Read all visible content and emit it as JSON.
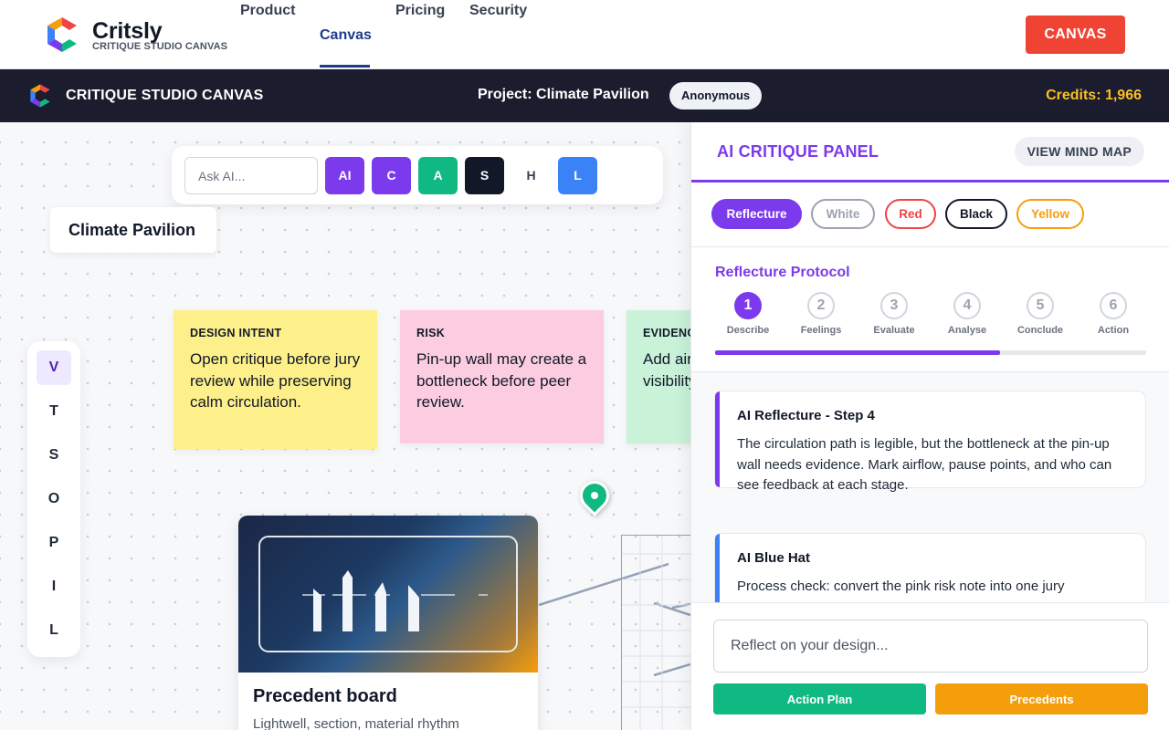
{
  "brand": {
    "name": "Critsly",
    "subtitle": "CRITIQUE STUDIO CANVAS",
    "logo_icon": "hexagon-c-logo-icon"
  },
  "nav": {
    "links": [
      "Product",
      "Canvas",
      "Pricing",
      "Security"
    ],
    "active": "Canvas",
    "cta_label": "CANVAS"
  },
  "toolbar": {
    "title": "CRITIQUE STUDIO CANVAS",
    "project": "Project: Climate Pavilion",
    "user_badge": "Anonymous",
    "credits": "Credits: 1,966"
  },
  "canvas": {
    "ask": {
      "placeholder": "Ask AI..."
    },
    "hat_buttons": [
      {
        "label": "AI",
        "color": "#7c3aed"
      },
      {
        "label": "C",
        "color": "#7c3aed"
      },
      {
        "label": "A",
        "color": "#10b981"
      },
      {
        "label": "S",
        "color": "#111827"
      },
      {
        "label": "H",
        "color": "#ffffff"
      },
      {
        "label": "L",
        "color": "#3b82f6"
      }
    ],
    "title_card": "Climate Pavilion",
    "stickies": [
      {
        "tag": "DESIGN INTENT",
        "body": "Open critique before jury review while preserving calm circulation.",
        "color": "#fdf08a"
      },
      {
        "tag": "RISK",
        "body": "Pin-up wall may create a bottleneck before peer review.",
        "color": "#fccde0"
      },
      {
        "tag": "EVIDENCE",
        "body": "Add airflow pause visibility",
        "color": "#c9f2d9"
      }
    ],
    "tools": [
      "V",
      "T",
      "S",
      "O",
      "P",
      "I",
      "L"
    ],
    "active_tool": "V",
    "precedent": {
      "title": "Precedent board",
      "subtitle": "Lightwell, section, material rhythm"
    }
  },
  "panel": {
    "title": "AI CRITIQUE PANEL",
    "mindmap_button": "VIEW MIND MAP",
    "chips": [
      {
        "label": "Reflecture",
        "color": "#7c3aed",
        "filled": true
      },
      {
        "label": "White",
        "color": "#9ca3af",
        "filled": false
      },
      {
        "label": "Red",
        "color": "#ef4444",
        "filled": false
      },
      {
        "label": "Black",
        "color": "#111827",
        "filled": false
      },
      {
        "label": "Yellow",
        "color": "#f59e0b",
        "filled": false
      }
    ],
    "protocol_title": "Reflecture Protocol",
    "steps": [
      {
        "num": "1",
        "label": "Describe"
      },
      {
        "num": "2",
        "label": "Feelings"
      },
      {
        "num": "3",
        "label": "Evaluate"
      },
      {
        "num": "4",
        "label": "Analyse"
      },
      {
        "num": "5",
        "label": "Conclude"
      },
      {
        "num": "6",
        "label": "Action"
      }
    ],
    "active_step": 1,
    "progress_fraction": 0.66,
    "cards": [
      {
        "title": "AI Reflecture - Step 4",
        "body": "The circulation path is legible, but the bottleneck at the pin-up wall needs evidence. Mark airflow, pause points, and who can see feedback at each stage.",
        "accent": "#7c3aed"
      },
      {
        "title": "AI Blue Hat",
        "body": "Process check: convert the pink risk note into one jury",
        "accent": "#3b82f6"
      }
    ],
    "composer": {
      "placeholder": "Reflect on your design...",
      "action_plan": "Action Plan",
      "precedents": "Precedents",
      "action_color": "#10b981",
      "precedents_color": "#f59e0b"
    }
  }
}
